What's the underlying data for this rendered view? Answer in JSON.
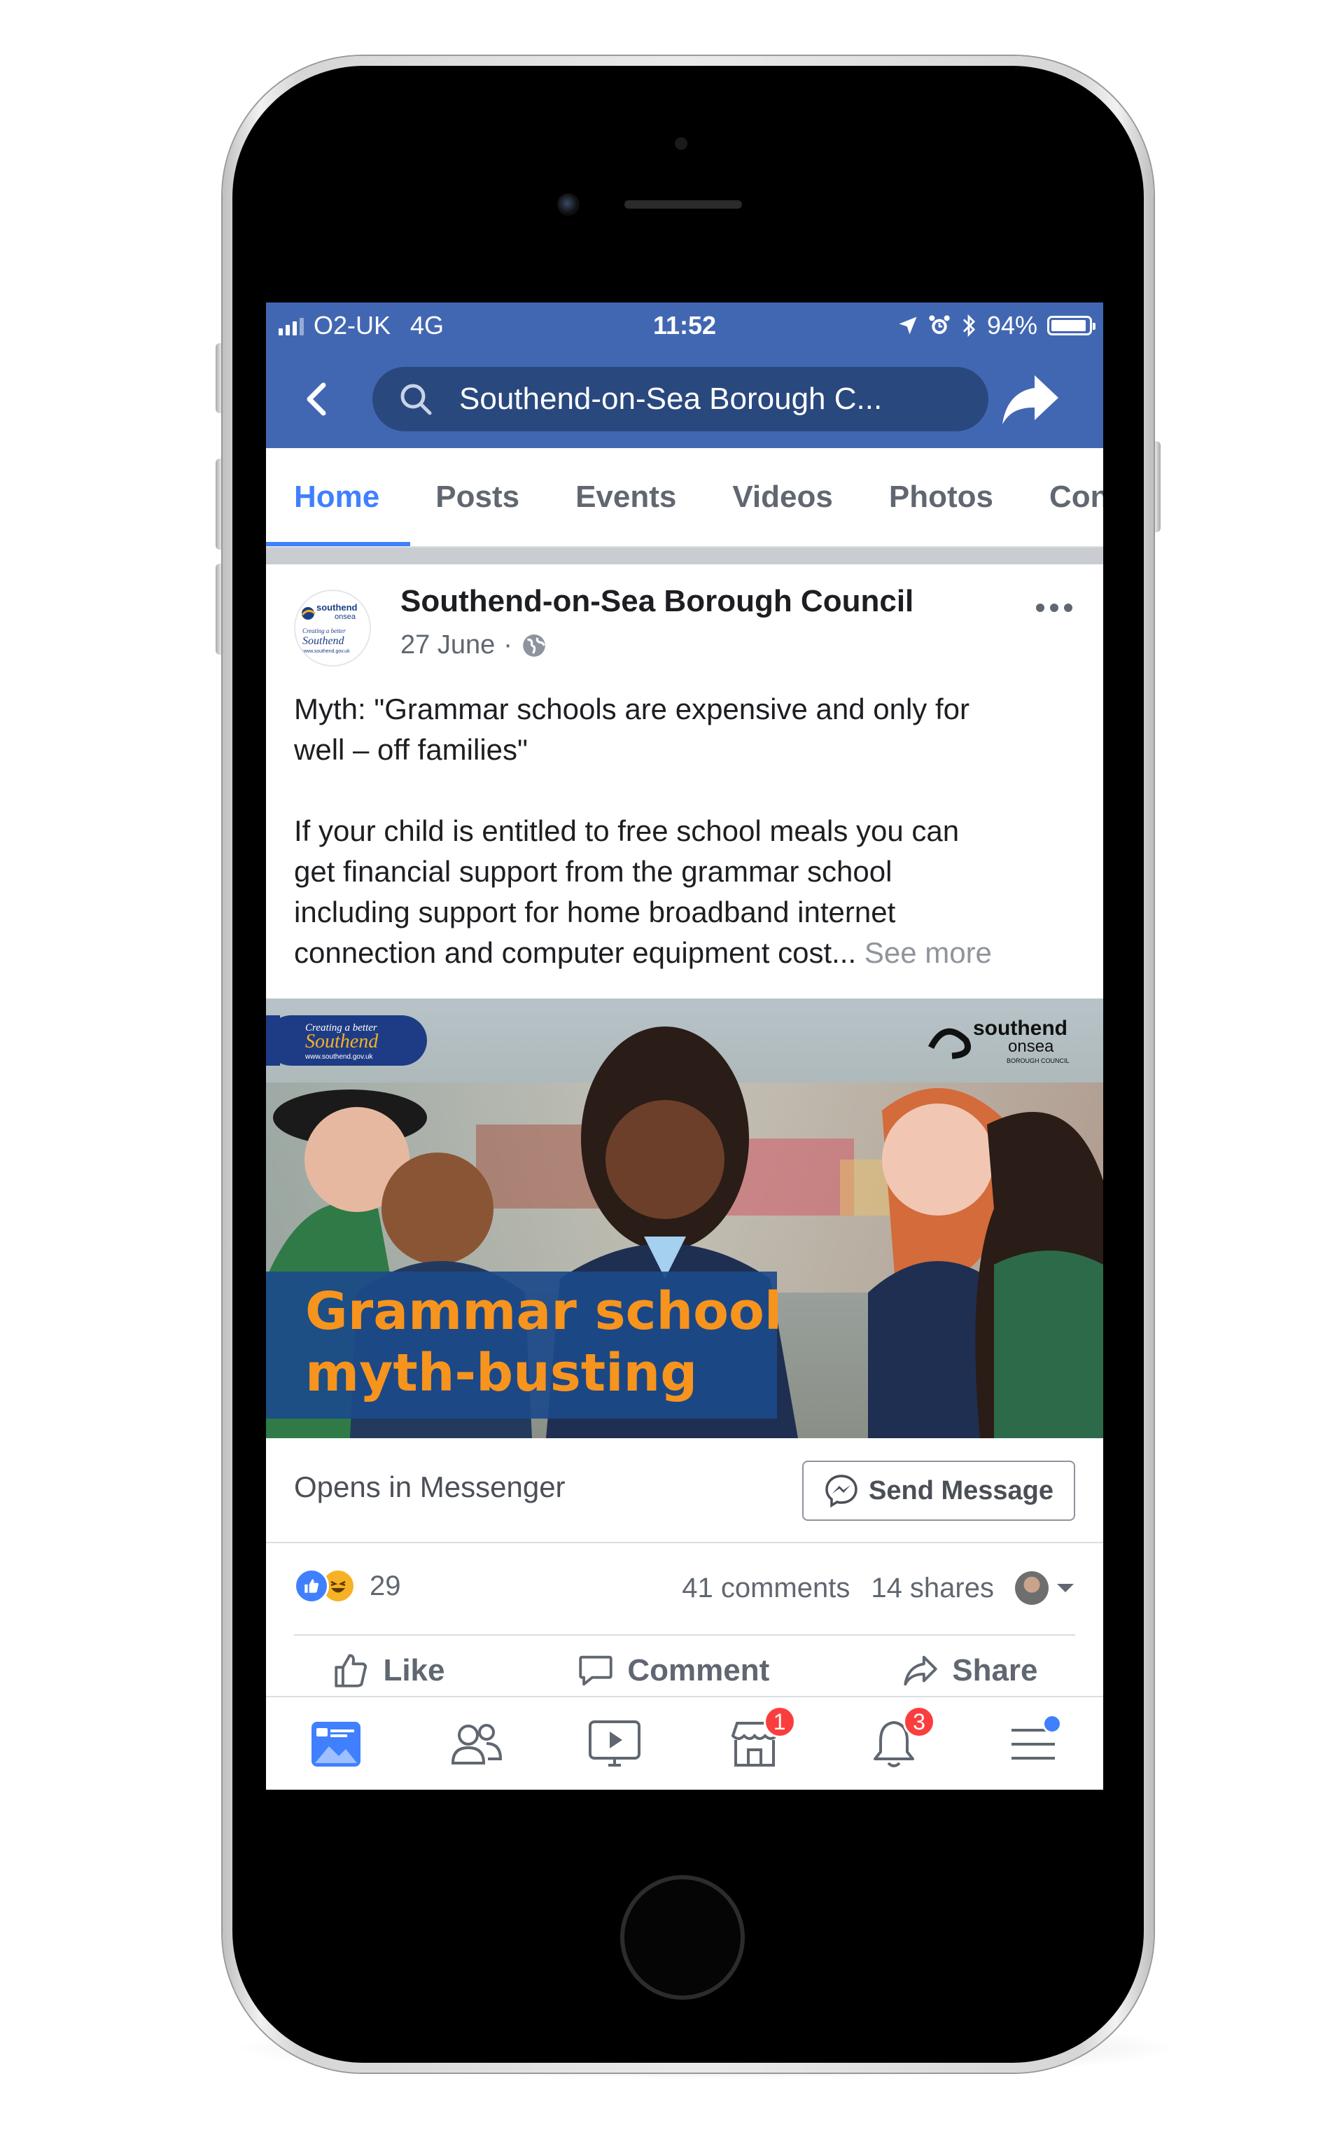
{
  "status_bar": {
    "carrier": "O2-UK",
    "network": "4G",
    "time": "11:52",
    "battery": "94%",
    "battery_level": 0.94
  },
  "nav": {
    "search_text": "Southend-on-Sea Borough C..."
  },
  "tabs": [
    {
      "label": "Home",
      "active": true
    },
    {
      "label": "Posts",
      "active": false
    },
    {
      "label": "Events",
      "active": false
    },
    {
      "label": "Videos",
      "active": false
    },
    {
      "label": "Photos",
      "active": false
    },
    {
      "label": "Con",
      "active": false
    }
  ],
  "post": {
    "page_name": "Southend-on-Sea Borough Council",
    "date": "27 June",
    "separator": "·",
    "avatar_text": {
      "brand_line1": "southend",
      "brand_line2": "onsea",
      "tagline_small": "Creating a better",
      "tagline_big": "Southend",
      "url": "www.southend.gov.uk"
    },
    "text_line1": "Myth: \"Grammar schools are expensive and only for",
    "text_line2": "well – off families\"",
    "text_line3": "If your child is entitled to free school meals you can",
    "text_line4": "get financial support from the grammar school",
    "text_line5": "including support for home broadband internet",
    "text_line6": "connection and computer equipment cost...",
    "see_more": "See more",
    "image": {
      "badge_line1": "Creating a better",
      "badge_line2": "Southend",
      "badge_line3": "www.southend.gov.uk",
      "logo_line1": "southend",
      "logo_line2": "onsea",
      "logo_line3": "BOROUGH COUNCIL",
      "headline_line1": "Grammar school",
      "headline_line2": "myth-busting"
    },
    "cta_text": "Opens in Messenger",
    "cta_button": "Send Message",
    "reaction_count": "29",
    "comments": "41 comments",
    "shares": "14 shares",
    "actions": {
      "like": "Like",
      "comment": "Comment",
      "share": "Share"
    }
  },
  "bottom_bar": {
    "marketplace_badge": "1",
    "notifications_badge": "3"
  },
  "colors": {
    "facebook_blue": "#4267b2",
    "active_tab": "#4080ff",
    "badge_red": "#fa3e3e",
    "headline_orange": "#f7941d"
  },
  "icons": [
    "back-icon",
    "search-icon",
    "share-arrow-icon",
    "globe-icon",
    "more-icon",
    "messenger-icon",
    "like-reaction-icon",
    "haha-reaction-icon",
    "viewer-avatar-icon",
    "chevron-down-icon",
    "thumbs-up-icon",
    "comment-icon",
    "share-icon",
    "news-feed-icon",
    "friends-icon",
    "watch-icon",
    "marketplace-icon",
    "notifications-icon",
    "menu-icon"
  ]
}
